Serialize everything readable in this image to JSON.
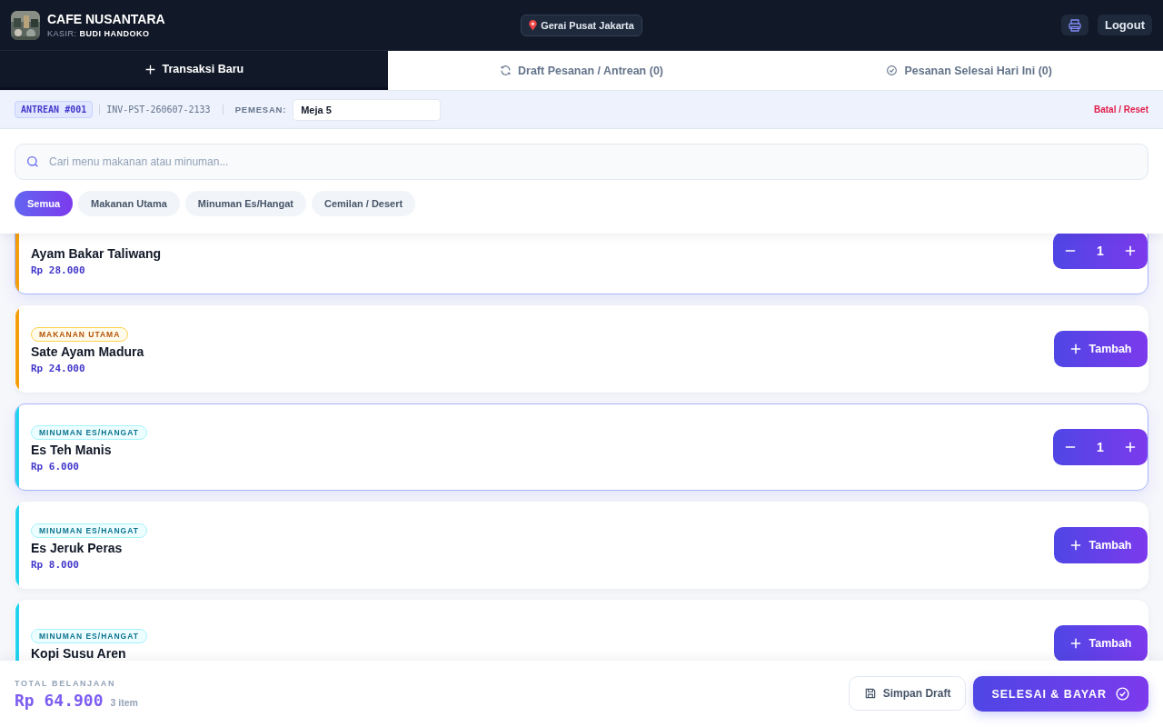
{
  "header": {
    "title": "CAFE NUSANTARA",
    "cashier_label": "KASIR:",
    "cashier": "BUDI HANDOKO",
    "outlet": "Gerai Pusat Jakarta",
    "logout": "Logout"
  },
  "tabs": [
    {
      "label": "Transaksi Baru",
      "selected": true
    },
    {
      "label": "Draft Pesanan / Antrean (0)",
      "selected": false
    },
    {
      "label": "Pesanan Selesai Hari Ini (0)",
      "selected": false
    }
  ],
  "order_bar": {
    "queue": "ANTREAN #001",
    "invoice": "INV-PST-260607-2133",
    "customer_label": "PEMESAN:",
    "customer": "Meja 5",
    "reset": "Batal / Reset"
  },
  "search": {
    "placeholder": "Cari menu makanan atau minuman..."
  },
  "categories": [
    {
      "label": "Semua",
      "selected": true
    },
    {
      "label": "Makanan Utama",
      "selected": false
    },
    {
      "label": "Minuman Es/Hangat",
      "selected": false
    },
    {
      "label": "Cemilan / Desert",
      "selected": false
    }
  ],
  "menu_items": [
    {
      "name": "Ayam Bakar Taliwang",
      "price": "Rp 28.000",
      "color": "#f59e0b",
      "in_cart": true,
      "qty": "1"
    },
    {
      "tag": "MAKANAN UTAMA",
      "name": "Sate Ayam Madura",
      "price": "Rp 24.000",
      "color": "#f59e0b",
      "in_cart": false,
      "add": "Tambah"
    },
    {
      "tag": "MINUMAN ES/HANGAT",
      "name": "Es Teh Manis",
      "price": "Rp 6.000",
      "color": "#22d3ee",
      "in_cart": true,
      "qty": "1"
    },
    {
      "tag": "MINUMAN ES/HANGAT",
      "name": "Es Jeruk Peras",
      "price": "Rp 8.000",
      "color": "#22d3ee",
      "in_cart": false,
      "add": "Tambah"
    },
    {
      "tag": "MINUMAN ES/HANGAT",
      "name": "Kopi Susu Aren",
      "color": "#22d3ee",
      "in_cart": false,
      "add": "Tambah"
    }
  ],
  "footer": {
    "total_label": "TOTAL BELANJAAN",
    "total": "Rp 64.900",
    "count": "3 item",
    "draft": "Simpan Draft",
    "pay": "SELESAI & BAYAR"
  }
}
